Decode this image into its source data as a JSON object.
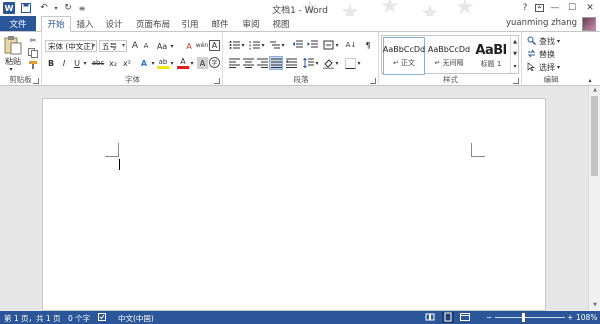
{
  "titlebar": {
    "title": "文档1 - Word",
    "logo_letter": "W",
    "help": "?",
    "controls": [
      "—",
      "☐",
      "✕"
    ]
  },
  "tabs": {
    "file": "文件",
    "items": [
      "开始",
      "插入",
      "设计",
      "页面布局",
      "引用",
      "邮件",
      "审阅",
      "视图"
    ],
    "user": "yuanming zhang"
  },
  "ribbon": {
    "clipboard": {
      "paste": "粘贴",
      "label": "剪贴板"
    },
    "font": {
      "name": "宋体 (中文正)",
      "size": "五号",
      "grow": "A",
      "shrink": "A",
      "case": "Aa",
      "clear": "A",
      "pinyin": "wén",
      "border_char": "A",
      "bold": "B",
      "italic": "I",
      "underline": "U",
      "strike": "abc",
      "subscript": "x₂",
      "superscript": "x²",
      "effects": "A",
      "highlight": "ab",
      "color": "A",
      "shade": "A",
      "circle": "字",
      "label": "字体"
    },
    "paragraph": {
      "label": "段落",
      "sort": "A↓",
      "marks": "¶"
    },
    "styles": {
      "items": [
        {
          "sample": "AaBbCcDd",
          "name": "↵ 正文"
        },
        {
          "sample": "AaBbCcDd",
          "name": "↵ 无间隔"
        },
        {
          "sample": "AaBl",
          "name": "标题 1"
        }
      ],
      "label": "样式"
    },
    "editing": {
      "find": "查找",
      "replace": "替换",
      "select": "选择",
      "label": "编辑"
    }
  },
  "statusbar": {
    "page": "第 1 页，共 1 页",
    "words": "0 个字",
    "language": "中文(中国)",
    "zoom": "108%",
    "minus": "−",
    "plus": "+"
  }
}
